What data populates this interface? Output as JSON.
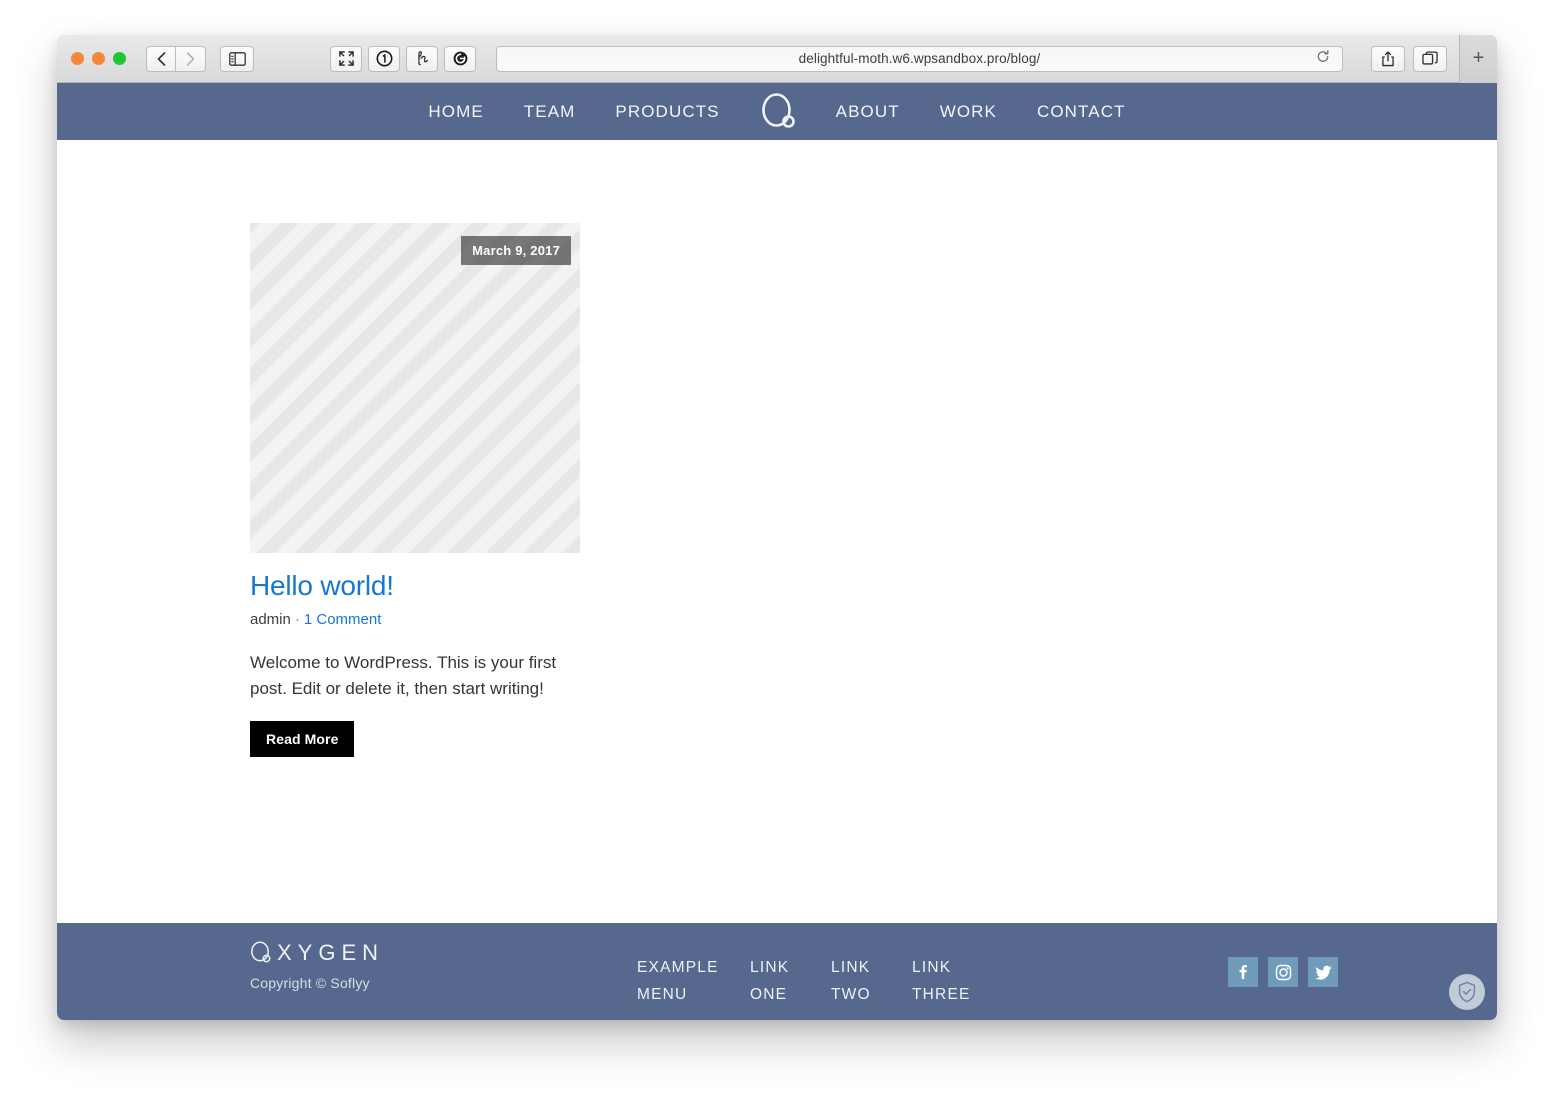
{
  "browser": {
    "url": "delightful-moth.w6.wpsandbox.pro/blog/",
    "back_label": "‹",
    "forward_label": "›",
    "plus_label": "+",
    "icons": {
      "sidebar": "sidebar-icon",
      "fullscreen": "fullscreen-icon",
      "onepassword": "onepassword-icon",
      "honey": "honey-icon",
      "grammarly": "grammarly-icon",
      "share": "share-icon",
      "tabs": "tabs-icon",
      "reload": "reload-icon"
    },
    "traffic_lights": {
      "close": "#f5873c",
      "minimize": "#f5873c",
      "maximize": "#22c533"
    }
  },
  "site": {
    "nav": {
      "logo_name": "oxygen-logo",
      "items_left": [
        {
          "label": "HOME"
        },
        {
          "label": "TEAM"
        },
        {
          "label": "PRODUCTS"
        }
      ],
      "items_right": [
        {
          "label": "ABOUT"
        },
        {
          "label": "WORK"
        },
        {
          "label": "CONTACT"
        }
      ]
    },
    "post": {
      "date": "March 9, 2017",
      "title": "Hello world!",
      "author": "admin",
      "separator": "·",
      "comments": "1 Comment",
      "excerpt": "Welcome to WordPress. This is your first post. Edit or delete it, then start writing!",
      "read_more": "Read More"
    },
    "footer": {
      "brand": "XYGEN",
      "copyright": "Copyright © Soflyy",
      "menu": [
        {
          "line1": "EXAMPLE",
          "line2": "MENU"
        },
        {
          "line1": "LINK",
          "line2": "ONE"
        },
        {
          "line1": "LINK",
          "line2": "TWO"
        },
        {
          "line1": "LINK",
          "line2": "THREE"
        }
      ],
      "social": [
        {
          "name": "facebook",
          "glyph": "f"
        },
        {
          "name": "instagram",
          "glyph": ""
        },
        {
          "name": "twitter",
          "glyph": ""
        }
      ]
    }
  },
  "colors": {
    "brand_blue": "#56688d",
    "link_blue": "#1878d0",
    "social_tile": "#719bba",
    "button_black": "#000000"
  }
}
